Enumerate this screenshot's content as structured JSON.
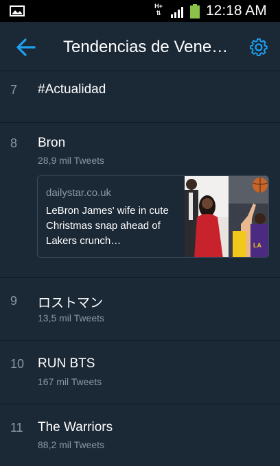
{
  "status_bar": {
    "network": "H+",
    "time": "12:18 AM",
    "icons": [
      "image-icon",
      "network-arrows-icon",
      "signal-icon",
      "battery-icon"
    ]
  },
  "header": {
    "title": "Tendencias de Venezuela",
    "back_icon": "back-arrow-icon",
    "settings_icon": "gear-icon"
  },
  "colors": {
    "background": "#1b2836",
    "accent": "#1da1f2",
    "secondary_text": "#8899a6",
    "divider": "#0f1722"
  },
  "trends": [
    {
      "rank": "7",
      "name": "#Actualidad",
      "tweets": ""
    },
    {
      "rank": "8",
      "name": "Bron",
      "tweets": "28,9 mil Tweets",
      "card": {
        "source": "dailystar.co.uk",
        "headline": "LeBron James' wife in cute Christmas snap ahead of Lakers crunch…"
      }
    },
    {
      "rank": "9",
      "name": "ロストマン",
      "tweets": "13,5 mil Tweets"
    },
    {
      "rank": "10",
      "name": "RUN BTS",
      "tweets": "167 mil Tweets"
    },
    {
      "rank": "11",
      "name": "The Warriors",
      "tweets": "88,2 mil Tweets"
    }
  ]
}
